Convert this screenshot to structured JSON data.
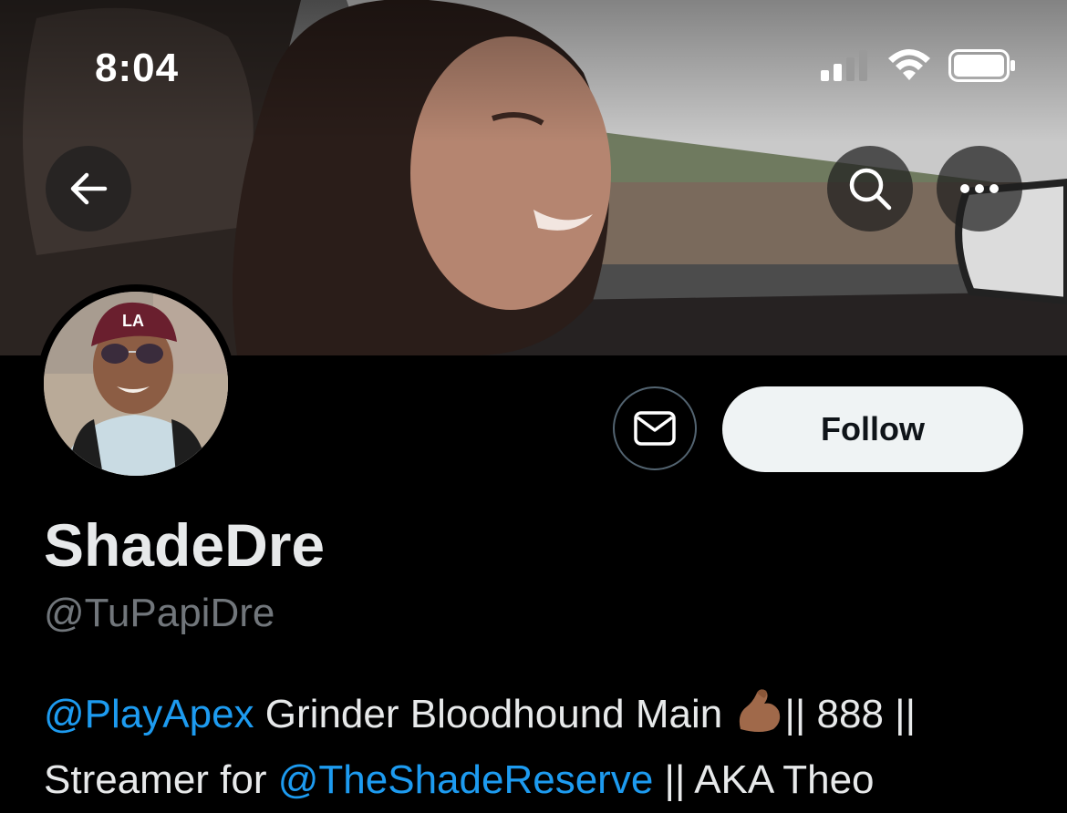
{
  "status_bar": {
    "time": "8:04"
  },
  "nav": {
    "back_icon": "arrow-left-icon",
    "search_icon": "search-icon",
    "more_icon": "more-horizontal-icon"
  },
  "actions": {
    "message_icon": "mail-icon",
    "follow_label": "Follow"
  },
  "profile": {
    "display_name": "ShadeDre",
    "handle": "@TuPapiDre",
    "bio": {
      "mention_1": "@PlayApex",
      "text_1": " Grinder Bloodhound Main ",
      "emoji": "flexed-biceps-emoji",
      "text_2": "|| 888 ||",
      "text_3": "Streamer for ",
      "mention_2": "@TheShadeReserve",
      "text_4": " || AKA Theo"
    }
  },
  "colors": {
    "background": "#000000",
    "link": "#1d9bf0",
    "follow_bg": "#eff3f4",
    "secondary_text": "#71767b"
  }
}
